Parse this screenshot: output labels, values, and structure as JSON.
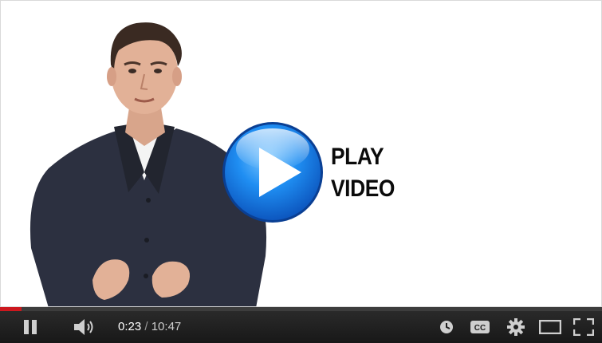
{
  "overlay": {
    "line1": "PLAY",
    "line2": "VIDEO"
  },
  "player": {
    "current_time": "0:23",
    "separator": " / ",
    "duration": "10:47",
    "progress_fraction": 0.036,
    "progress_color": "#cc181e"
  },
  "icons": {
    "play_overlay": "play-circle-icon",
    "pause": "pause-icon",
    "volume": "volume-icon",
    "watch_later": "clock-icon",
    "captions": "cc-icon",
    "settings": "gear-icon",
    "theater": "theater-mode-icon",
    "fullscreen": "fullscreen-icon"
  },
  "captions_label": "CC"
}
